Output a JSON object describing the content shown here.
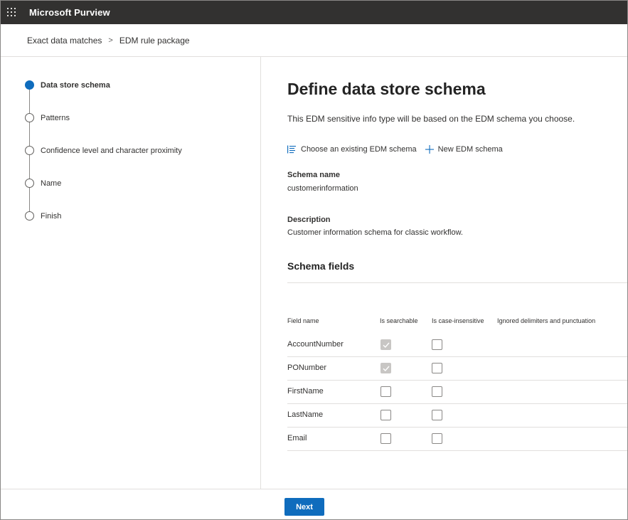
{
  "app": {
    "title": "Microsoft Purview"
  },
  "breadcrumb": {
    "items": [
      "Exact data matches",
      "EDM rule package"
    ],
    "separator": ">"
  },
  "steps": [
    {
      "label": "Data store schema",
      "state": "current"
    },
    {
      "label": "Patterns",
      "state": "pending"
    },
    {
      "label": "Confidence level and character proximity",
      "state": "pending"
    },
    {
      "label": "Name",
      "state": "pending"
    },
    {
      "label": "Finish",
      "state": "pending"
    }
  ],
  "main": {
    "title": "Define data store schema",
    "subtitle": "This EDM sensitive info type will be based on the EDM schema you choose.",
    "commands": {
      "choose_existing": "Choose an existing EDM schema",
      "new_schema": "New EDM schema"
    },
    "schema_name": {
      "label": "Schema name",
      "value": "customerinformation"
    },
    "description": {
      "label": "Description",
      "value": "Customer information schema for classic workflow."
    },
    "schema_fields_heading": "Schema fields",
    "table": {
      "columns": [
        "Field name",
        "Is searchable",
        "Is case-insensitive",
        "Ignored delimiters and punctuation"
      ],
      "rows": [
        {
          "name": "AccountNumber",
          "searchable": true,
          "case_insensitive": false
        },
        {
          "name": "PONumber",
          "searchable": true,
          "case_insensitive": false
        },
        {
          "name": "FirstName",
          "searchable": false,
          "case_insensitive": false
        },
        {
          "name": "LastName",
          "searchable": false,
          "case_insensitive": false
        },
        {
          "name": "Email",
          "searchable": false,
          "case_insensitive": false
        }
      ]
    }
  },
  "footer": {
    "next_label": "Next"
  },
  "colors": {
    "accent": "#0f6cbd",
    "topbar": "#323130"
  }
}
